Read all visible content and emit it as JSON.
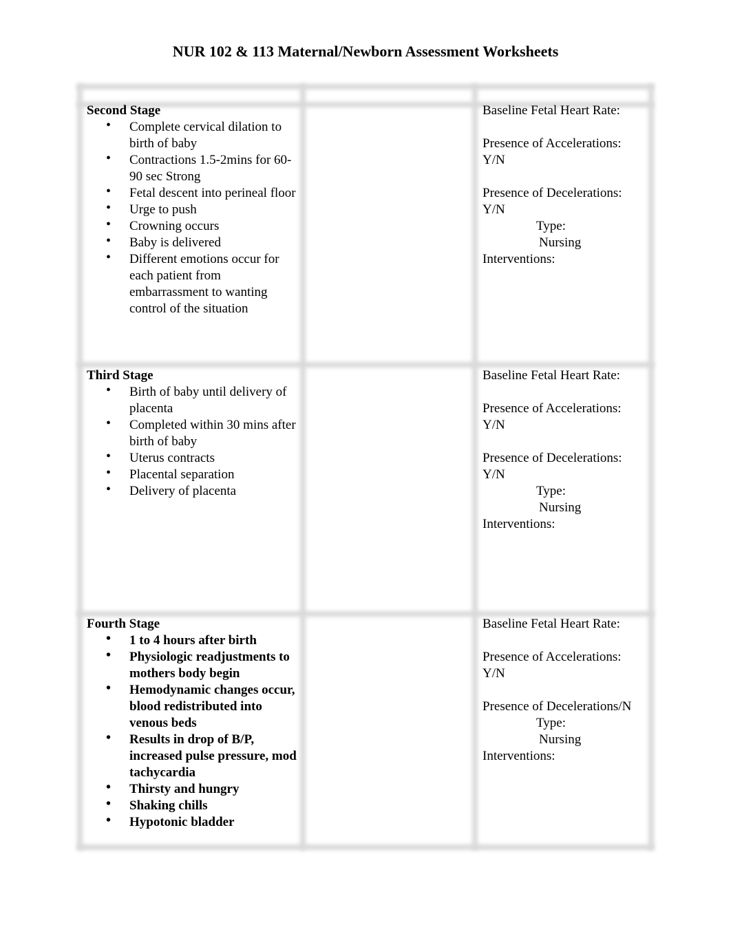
{
  "document": {
    "title": "NUR 102 & 113 Maternal/Newborn Assessment Worksheets"
  },
  "stages": [
    {
      "title": "Second Stage",
      "bold_items": false,
      "items": [
        "Complete cervical dilation to birth of baby",
        "Contractions 1.5-2mins for 60-90 sec Strong",
        "Fetal descent into perineal floor",
        "Urge to push",
        "Crowning occurs",
        "Baby is delivered",
        "Different emotions occur for each patient from embarrassment to wanting control of the situation"
      ],
      "assessment": {
        "baseline": "Baseline Fetal Heart Rate:",
        "accelerations": "Presence of Accelerations:",
        "accelerations_yn": "Y/N",
        "decelerations": "Presence of Decelerations:",
        "decelerations_yn": "Y/N",
        "type": "Type:",
        "nursing": "Nursing",
        "interventions": "Interventions:"
      }
    },
    {
      "title": "Third Stage",
      "bold_items": false,
      "items": [
        "Birth of baby until delivery of placenta",
        "Completed within 30 mins after birth of baby",
        "Uterus contracts",
        "Placental separation",
        "Delivery of placenta"
      ],
      "assessment": {
        "baseline": "Baseline Fetal Heart Rate:",
        "accelerations": "Presence of Accelerations:",
        "accelerations_yn": "Y/N",
        "decelerations": "Presence of Decelerations:",
        "decelerations_yn": "Y/N",
        "type": "Type:",
        "nursing": "Nursing",
        "interventions": "Interventions:"
      }
    },
    {
      "title": "Fourth Stage",
      "bold_items": true,
      "items": [
        "1 to 4 hours after birth",
        "Physiologic readjustments to mothers body begin",
        "Hemodynamic changes occur, blood redistributed into venous beds",
        "Results in drop of B/P, increased pulse pressure, mod tachycardia",
        "Thirsty and hungry",
        "Shaking chills",
        "Hypotonic bladder"
      ],
      "assessment": {
        "baseline": "Baseline Fetal Heart Rate:",
        "accelerations": "Presence of Accelerations:",
        "accelerations_yn": "Y/N",
        "decelerations": "Presence of Decelerations/N",
        "type": "Type:",
        "nursing": "Nursing",
        "interventions": "Interventions:"
      }
    }
  ]
}
